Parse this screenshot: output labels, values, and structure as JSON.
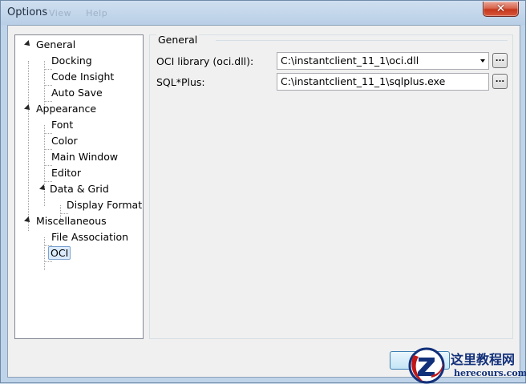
{
  "window": {
    "title": "Options",
    "ghost_menu": [
      "View",
      "Help"
    ],
    "close_glyph": "✕"
  },
  "tree": {
    "items": [
      {
        "label": "General",
        "level": 0,
        "expanded": true
      },
      {
        "label": "Docking",
        "level": 1
      },
      {
        "label": "Code Insight",
        "level": 1
      },
      {
        "label": "Auto Save",
        "level": 1
      },
      {
        "label": "Appearance",
        "level": 0,
        "expanded": true
      },
      {
        "label": "Font",
        "level": 1
      },
      {
        "label": "Color",
        "level": 1
      },
      {
        "label": "Main Window",
        "level": 1
      },
      {
        "label": "Editor",
        "level": 1
      },
      {
        "label": "Data & Grid",
        "level": 1,
        "expanded": true
      },
      {
        "label": "Display Format",
        "level": 2
      },
      {
        "label": "Miscellaneous",
        "level": 0,
        "expanded": true
      },
      {
        "label": "File Association",
        "level": 1
      },
      {
        "label": "OCI",
        "level": 1,
        "selected": true
      }
    ]
  },
  "panel": {
    "group_title": "General",
    "oci_label": "OCI library (oci.dll):",
    "oci_value": "C:\\instantclient_11_1\\oci.dll",
    "sqlplus_label": "SQL*Plus:",
    "sqlplus_value": "C:\\instantclient_11_1\\sqlplus.exe",
    "browse_label": "..."
  },
  "watermark": {
    "title": "这里教程网",
    "url": "herecours.com"
  },
  "colors": {
    "selection": "#dcebfc",
    "close_red": "#c7371c",
    "watermark_blue": "#12307a"
  }
}
